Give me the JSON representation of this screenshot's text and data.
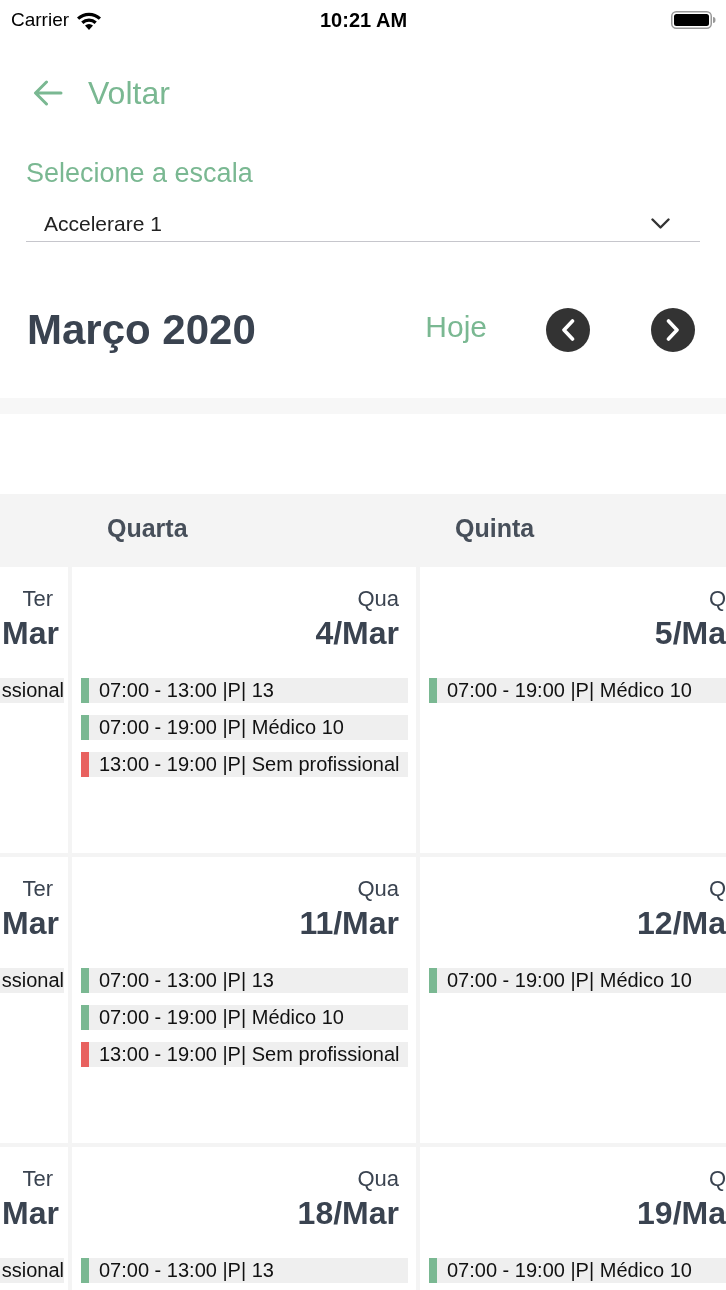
{
  "status_bar": {
    "carrier": "Carrier",
    "time": "10:21 AM"
  },
  "back": {
    "label": "Voltar"
  },
  "scale_select": {
    "label": "Selecione a escala",
    "value": "Accelerare 1"
  },
  "month_nav": {
    "title": "Março 2020",
    "today": "Hoje"
  },
  "calendar": {
    "headings": [
      "Quarta",
      "Quinta"
    ],
    "weeks": [
      {
        "days": [
          {
            "weekday": "Ter",
            "date": "Mar",
            "events": [
              {
                "text": "ssional"
              }
            ]
          },
          {
            "weekday": "Qua",
            "date": "4/Mar",
            "events": [
              {
                "text": "07:00 - 13:00 |P| 13",
                "color": "#7ab892"
              },
              {
                "text": "07:00 - 19:00 |P| Médico 10",
                "color": "#7ab892"
              },
              {
                "text": "13:00 - 19:00 |P| Sem profissional",
                "color": "#e8615f"
              }
            ]
          },
          {
            "weekday": "Q",
            "date": "5/Ma",
            "events": [
              {
                "text": "07:00 - 19:00 |P| Médico 10",
                "color": "#7ab892"
              }
            ]
          }
        ]
      },
      {
        "days": [
          {
            "weekday": "Ter",
            "date": "Mar",
            "events": [
              {
                "text": "ssional"
              }
            ]
          },
          {
            "weekday": "Qua",
            "date": "11/Mar",
            "events": [
              {
                "text": "07:00 - 13:00 |P| 13",
                "color": "#7ab892"
              },
              {
                "text": "07:00 - 19:00 |P| Médico 10",
                "color": "#7ab892"
              },
              {
                "text": "13:00 - 19:00 |P| Sem profissional",
                "color": "#e8615f"
              }
            ]
          },
          {
            "weekday": "Q",
            "date": "12/Ma",
            "events": [
              {
                "text": "07:00 - 19:00 |P| Médico 10",
                "color": "#7ab892"
              }
            ]
          }
        ]
      },
      {
        "days": [
          {
            "weekday": "Ter",
            "date": "Mar",
            "events": [
              {
                "text": "ssional"
              }
            ]
          },
          {
            "weekday": "Qua",
            "date": "18/Mar",
            "events": [
              {
                "text": "07:00 - 13:00 |P| 13",
                "color": "#7ab892"
              }
            ]
          },
          {
            "weekday": "Q",
            "date": "19/Ma",
            "events": [
              {
                "text": "07:00 - 19:00 |P| Médico 10",
                "color": "#7ab892"
              }
            ]
          }
        ]
      }
    ]
  }
}
